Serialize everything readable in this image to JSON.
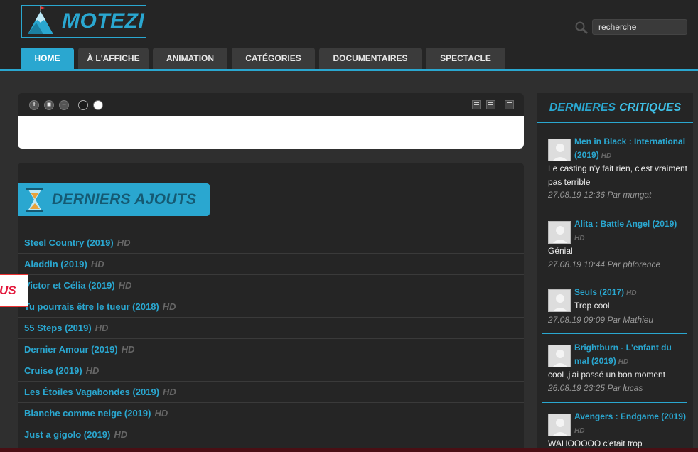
{
  "brand": {
    "name": "MOTEZI"
  },
  "search": {
    "placeholder": "recherche"
  },
  "nav": [
    {
      "label": "HOME",
      "active": true
    },
    {
      "label": "À L'AFFICHE"
    },
    {
      "label": "ANIMATION"
    },
    {
      "label": "CATÉGORIES"
    },
    {
      "label": "DOCUMENTAIRES"
    },
    {
      "label": "SPECTACLE"
    }
  ],
  "ajouts": {
    "title": "DERNIERS AJOUTS",
    "items": [
      {
        "title": "Steel Country (2019)",
        "badge": "HD"
      },
      {
        "title": "Aladdin (2019)",
        "badge": "HD"
      },
      {
        "title": "Victor et Célia (2019)",
        "badge": "HD"
      },
      {
        "title": "Tu pourrais être le tueur (2018)",
        "badge": "HD"
      },
      {
        "title": "55 Steps (2019)",
        "badge": "HD"
      },
      {
        "title": "Dernier Amour (2019)",
        "badge": "HD"
      },
      {
        "title": "Cruise (2019)",
        "badge": "HD"
      },
      {
        "title": "Les Étoiles Vagabondes (2019)",
        "badge": "HD"
      },
      {
        "title": "Blanche comme neige (2019)",
        "badge": "HD"
      },
      {
        "title": "Just a gigolo (2019)",
        "badge": "HD"
      }
    ]
  },
  "side_tab": {
    "label": "US"
  },
  "critiques": {
    "title_a": "DERNIERES",
    "title_b": "CRITIQUES",
    "items": [
      {
        "title": "Men in Black : International (2019)",
        "badge": "HD",
        "text": "Le casting n'y fait rien, c'est vraiment pas terrible",
        "meta": "27.08.19 12:36 Par mungat"
      },
      {
        "title": "Alita : Battle Angel (2019)",
        "badge": "HD",
        "text": "Génial",
        "meta": "27.08.19 10:44 Par phlorence"
      },
      {
        "title": "Seuls (2017)",
        "badge": "HD",
        "text": "Trop cool",
        "meta": "27.08.19 09:09 Par Mathieu"
      },
      {
        "title": "Brightburn - L'enfant du mal (2019)",
        "badge": "HD",
        "text": "cool ,j'ai passé un bon moment",
        "meta": "26.08.19 23:25 Par lucas"
      },
      {
        "title": "Avengers : Endgame (2019)",
        "badge": "HD",
        "text": "WAHOOOOO c'etait trop",
        "meta": ""
      }
    ]
  },
  "colors": {
    "accent": "#2aa7d0",
    "bg": "#2f2f2f",
    "panel": "#252525"
  }
}
